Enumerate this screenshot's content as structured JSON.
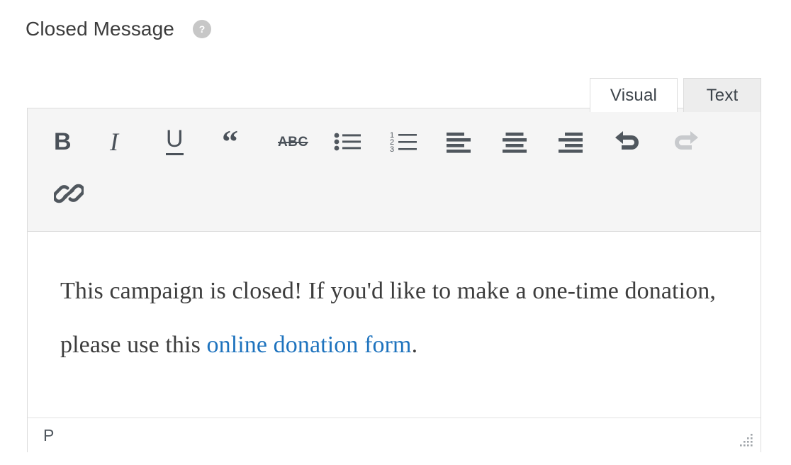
{
  "field": {
    "label": "Closed Message",
    "help_icon": "question-mark-circle-icon",
    "help_icon_color": "#c7c7c7"
  },
  "tabs": [
    {
      "id": "visual",
      "label": "Visual",
      "active": true
    },
    {
      "id": "text",
      "label": "Text",
      "active": false
    }
  ],
  "toolbar": {
    "rows": [
      [
        {
          "name": "bold-button",
          "icon": "bold-icon",
          "glyph": "B",
          "enabled": true
        },
        {
          "name": "italic-button",
          "icon": "italic-icon",
          "glyph": "I",
          "enabled": true
        },
        {
          "name": "underline-button",
          "icon": "underline-icon",
          "glyph": "U",
          "enabled": true
        },
        {
          "name": "blockquote-button",
          "icon": "blockquote-icon",
          "glyph": "“",
          "enabled": true
        },
        {
          "name": "strikethrough-button",
          "icon": "strikethrough-icon",
          "glyph": "ABC",
          "enabled": true
        },
        {
          "name": "bulleted-list-button",
          "icon": "unordered-list-icon",
          "glyph": "",
          "enabled": true
        },
        {
          "name": "numbered-list-button",
          "icon": "ordered-list-icon",
          "glyph": "",
          "enabled": true
        },
        {
          "name": "align-left-button",
          "icon": "align-left-icon",
          "glyph": "",
          "enabled": true
        },
        {
          "name": "align-center-button",
          "icon": "align-center-icon",
          "glyph": "",
          "enabled": true
        },
        {
          "name": "align-right-button",
          "icon": "align-right-icon",
          "glyph": "",
          "enabled": true
        },
        {
          "name": "undo-button",
          "icon": "undo-icon",
          "glyph": "",
          "enabled": true
        },
        {
          "name": "redo-button",
          "icon": "redo-icon",
          "glyph": "",
          "enabled": false
        }
      ],
      [
        {
          "name": "insert-link-button",
          "icon": "link-icon",
          "glyph": "",
          "enabled": true
        }
      ]
    ],
    "icon_color": "#4a5159",
    "disabled_color": "#c8cacd",
    "background": "#f5f5f5"
  },
  "content": {
    "paragraph_before_link": "This campaign is closed! If you'd like to make a one-time donation, please use this ",
    "link_text": "online donation form",
    "paragraph_after_link": ".",
    "link_color": "#1e73be",
    "text_color": "#3d3d3d"
  },
  "statusbar": {
    "element_path": "P",
    "resize_handle": "resize-grip-icon"
  }
}
